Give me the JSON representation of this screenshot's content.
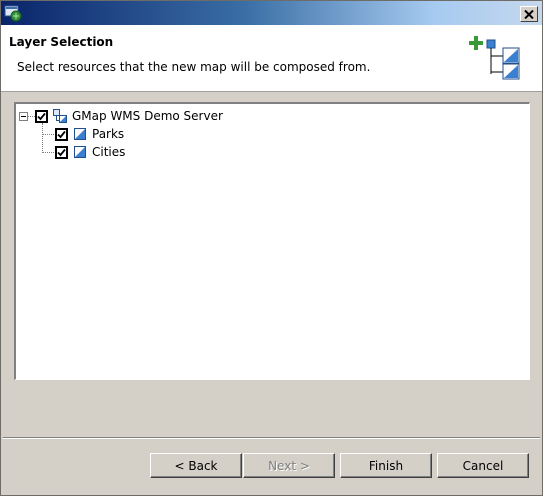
{
  "window": {
    "title": ""
  },
  "header": {
    "title": "Layer Selection",
    "description": "Select resources that the new map will be composed from."
  },
  "tree": {
    "root": {
      "label": "GMap WMS Demo Server",
      "checked": true,
      "expanded": true,
      "icon": "server-icon",
      "children": [
        {
          "label": "Parks",
          "checked": true,
          "icon": "layer-icon"
        },
        {
          "label": "Cities",
          "checked": true,
          "icon": "layer-icon"
        }
      ]
    }
  },
  "buttons": {
    "back": "< Back",
    "next": "Next >",
    "finish": "Finish",
    "cancel": "Cancel"
  },
  "colors": {
    "titlebar_start": "#0a246a",
    "titlebar_end": "#a6caf0",
    "dialog_bg": "#d4d0c8",
    "layer_icon_blue": "#3b7fd0",
    "plus_green": "#3a9a3a"
  }
}
